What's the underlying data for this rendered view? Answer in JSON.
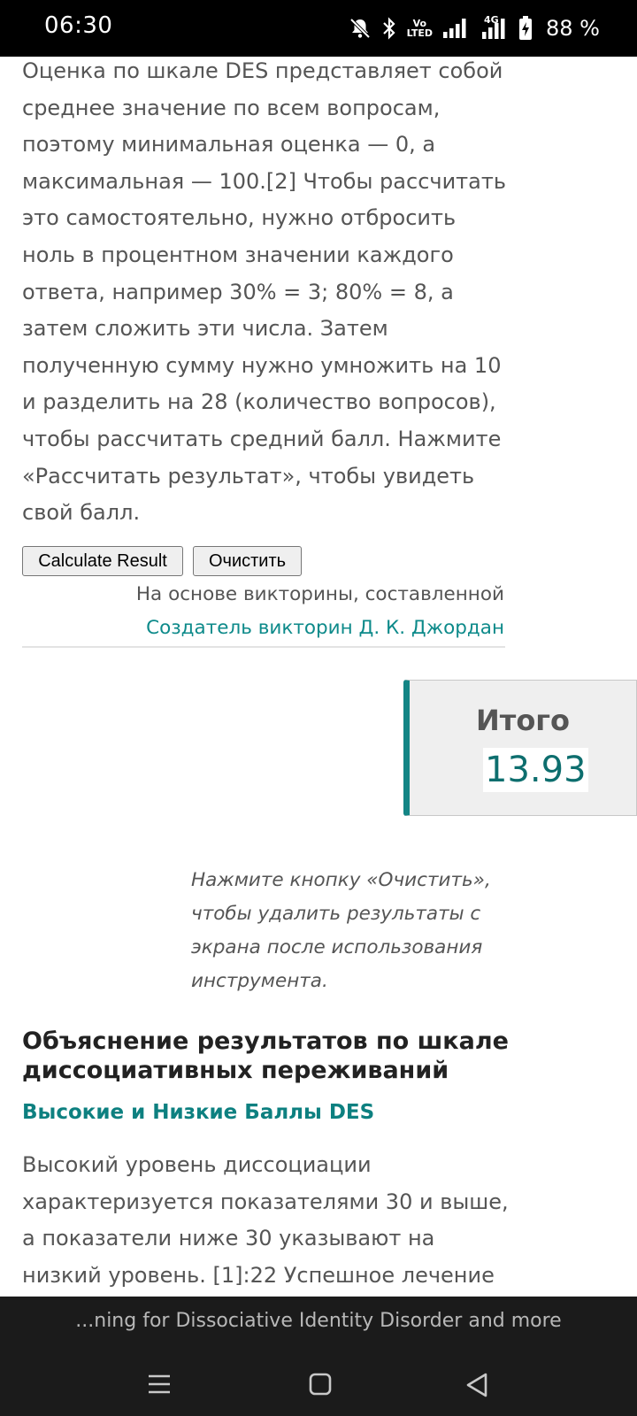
{
  "status_bar": {
    "time": "06:30",
    "network_volte": [
      "Vo",
      "LTED"
    ],
    "network_type": "4G",
    "battery_percent": "88 %",
    "icons": [
      "mute-icon",
      "bluetooth-icon",
      "volte-icon",
      "signal-icon",
      "signal-4g-icon",
      "battery-charging-icon"
    ]
  },
  "main": {
    "intro_text": "Оценка по шкале DES представляет собой среднее значение по всем вопросам, поэтому минимальная оценка — 0, а максимальная — 100.[2] Чтобы рассчитать это самостоятельно, нужно отбросить ноль в процентном значении каждого ответа, например 30% = 3; 80% = 8, а затем сложить эти числа. Затем полученную сумму нужно умножить на 10 и разделить на 28 (количество вопросов), чтобы рассчитать средний балл. Нажмите «Рассчитать результат», чтобы увидеть свой балл.",
    "buttons": {
      "calculate": "Calculate Result",
      "clear": "Очистить"
    },
    "credit": {
      "line": "На основе викторины, составленной",
      "link": "Создатель викторин Д. К. Джордан"
    },
    "result": {
      "title": "Итого",
      "value": "13.93"
    },
    "note": "Нажмите кнопку «Очистить», чтобы удалить результаты с экрана после использования инструмента.",
    "section_heading": "Объяснение результатов по шкале диссоциативных переживаний",
    "subheading": "Высокие и Низкие Баллы DES",
    "section_text": "Высокий уровень диссоциации характеризуется показателями 30 и выше, а показатели ниже 30 указывают на низкий уровень. [1]:22 Успешное лечение"
  },
  "banner": {
    "text": "...ning for Dissociative Identity Disorder and more"
  },
  "nav_bar": {
    "icons": [
      "menu-icon",
      "home-square-icon",
      "back-triangle-icon"
    ]
  },
  "colors": {
    "accent": "#0d8a8a",
    "result_bar": "#138585"
  }
}
